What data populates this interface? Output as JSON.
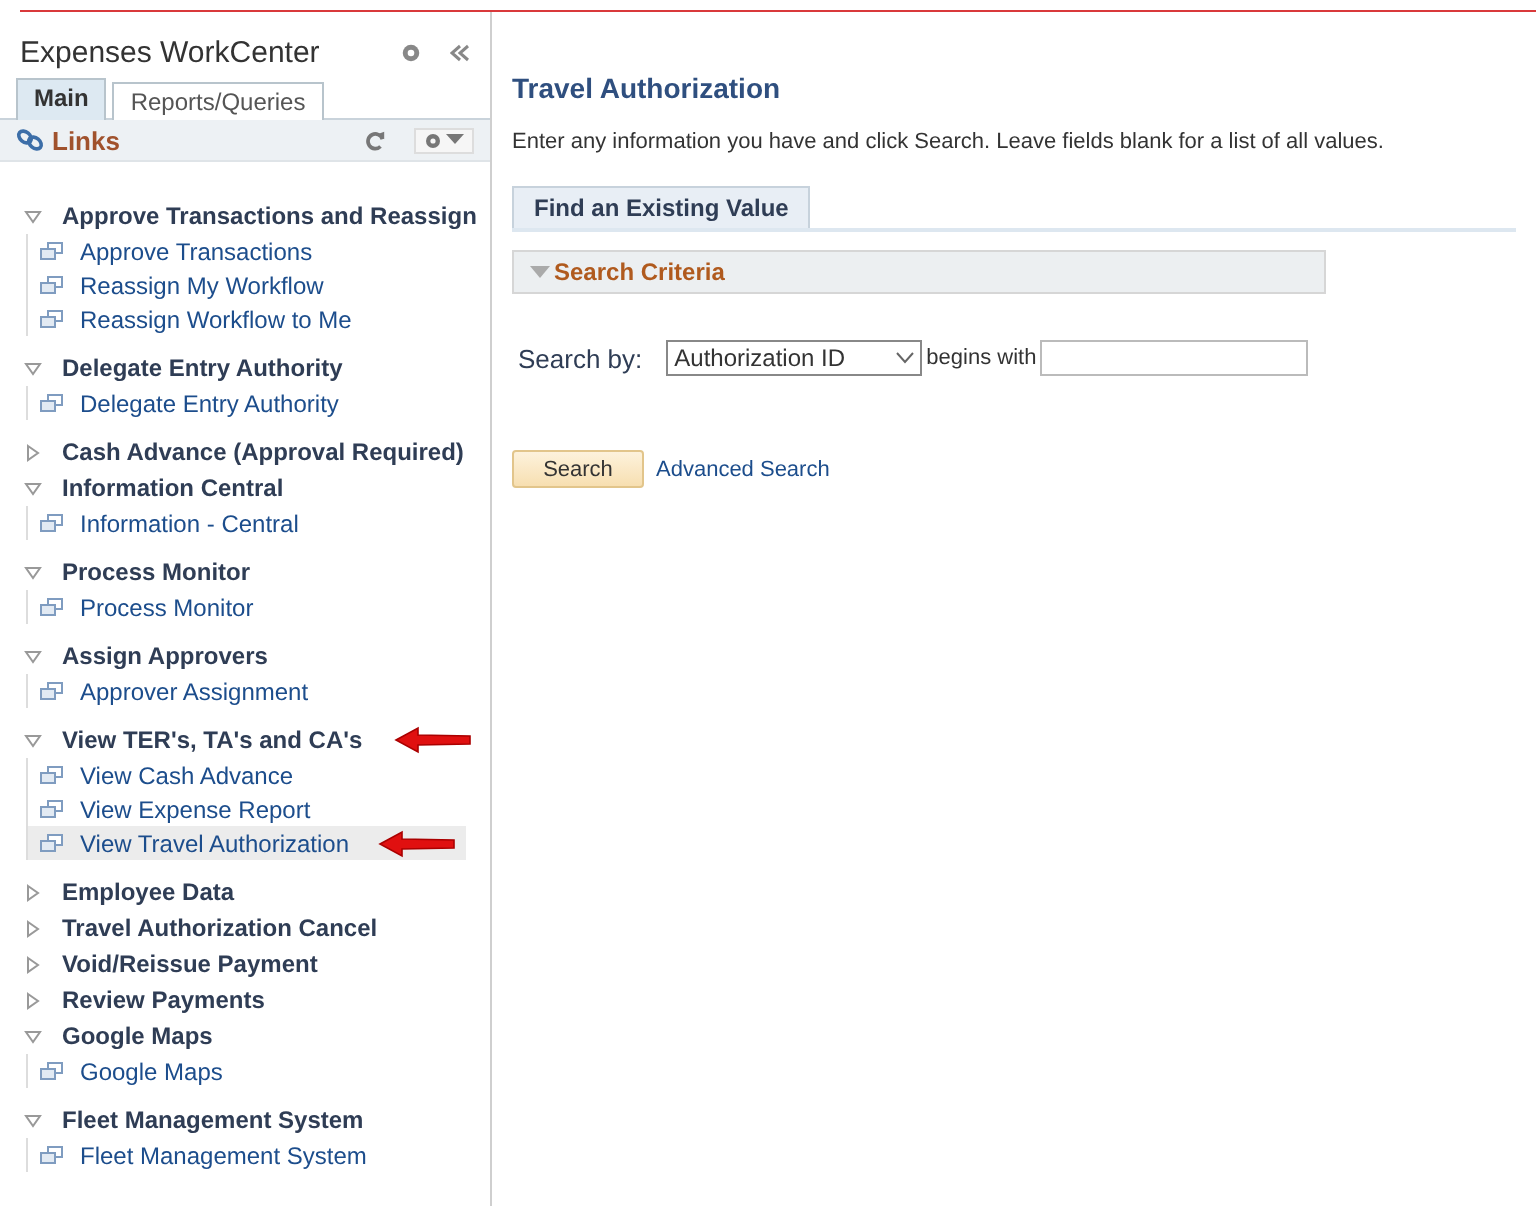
{
  "sidebar": {
    "title": "Expenses WorkCenter",
    "tabs": [
      {
        "label": "Main",
        "selected": true
      },
      {
        "label": "Reports/Queries",
        "selected": false
      }
    ],
    "links_title": "Links",
    "groups": [
      {
        "label": "Approve Transactions and Reassign",
        "expanded": true,
        "arrow": false,
        "items": [
          {
            "label": "Approve Transactions",
            "selected": false,
            "arrow": false
          },
          {
            "label": "Reassign My Workflow",
            "selected": false,
            "arrow": false
          },
          {
            "label": "Reassign Workflow to Me",
            "selected": false,
            "arrow": false
          }
        ]
      },
      {
        "label": "Delegate Entry Authority",
        "expanded": true,
        "arrow": false,
        "items": [
          {
            "label": "Delegate Entry Authority",
            "selected": false,
            "arrow": false
          }
        ]
      },
      {
        "label": "Cash Advance (Approval Required)",
        "expanded": false,
        "arrow": false
      },
      {
        "label": "Information Central",
        "expanded": true,
        "arrow": false,
        "items": [
          {
            "label": "Information - Central",
            "selected": false,
            "arrow": false
          }
        ]
      },
      {
        "label": "Process Monitor",
        "expanded": true,
        "arrow": false,
        "items": [
          {
            "label": "Process Monitor",
            "selected": false,
            "arrow": false
          }
        ]
      },
      {
        "label": "Assign Approvers",
        "expanded": true,
        "arrow": false,
        "items": [
          {
            "label": "Approver Assignment",
            "selected": false,
            "arrow": false
          }
        ]
      },
      {
        "label": "View TER's, TA's and CA's",
        "expanded": true,
        "arrow": true,
        "items": [
          {
            "label": "View Cash Advance",
            "selected": false,
            "arrow": false
          },
          {
            "label": "View Expense Report",
            "selected": false,
            "arrow": false
          },
          {
            "label": "View Travel Authorization",
            "selected": true,
            "arrow": true
          }
        ]
      },
      {
        "label": "Employee Data",
        "expanded": false,
        "arrow": false
      },
      {
        "label": "Travel Authorization Cancel",
        "expanded": false,
        "arrow": false
      },
      {
        "label": "Void/Reissue Payment",
        "expanded": false,
        "arrow": false
      },
      {
        "label": "Review Payments",
        "expanded": false,
        "arrow": false
      },
      {
        "label": "Google Maps",
        "expanded": true,
        "arrow": false,
        "items": [
          {
            "label": "Google Maps",
            "selected": false,
            "arrow": false
          }
        ]
      },
      {
        "label": "Fleet Management System",
        "expanded": true,
        "arrow": false,
        "items": [
          {
            "label": "Fleet Management System",
            "selected": false,
            "arrow": false
          }
        ]
      }
    ]
  },
  "main": {
    "title": "Travel Authorization",
    "instructions": "Enter any information you have and click Search. Leave fields blank for a list of all values.",
    "tab": {
      "label": "Find an Existing Value",
      "selected": true
    },
    "section": {
      "label": "Search Criteria",
      "expanded": true
    },
    "search_by_label": "Search by:",
    "search_by_value": "Authorization ID",
    "operator": "begins with",
    "buttons": [
      {
        "label": "Search",
        "kind": "button"
      },
      {
        "label": "Advanced Search",
        "kind": "link"
      }
    ]
  }
}
